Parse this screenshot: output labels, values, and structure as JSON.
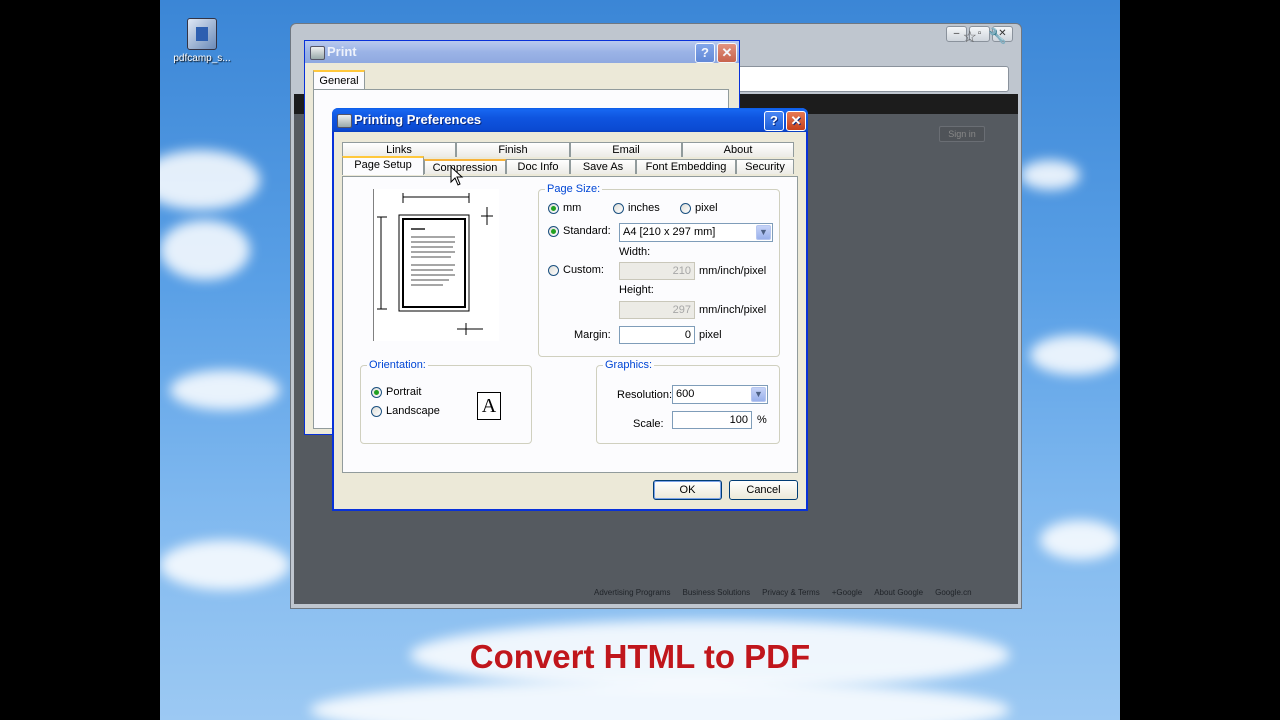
{
  "desktop": {
    "icon_label": "pdfcamp_s..."
  },
  "browser": {
    "controls": {
      "minimize": "–",
      "restore": "▫",
      "close": "✕"
    },
    "sign_in": "Sign in",
    "footer_links": [
      "Advertising Programs",
      "Business Solutions",
      "Privacy & Terms",
      "+Google",
      "About Google",
      "Google.cn"
    ]
  },
  "print_dialog": {
    "title": "Print",
    "tab": "General",
    "help": "?",
    "close": "✕"
  },
  "prefs": {
    "title": "Printing Preferences",
    "help": "?",
    "close": "✕",
    "tabs_row1": [
      "Links",
      "Finish",
      "Email",
      "About"
    ],
    "tabs_row2": [
      "Page Setup",
      "Compression",
      "Doc Info",
      "Save As",
      "Font Embedding",
      "Security"
    ],
    "selected_tab": "Page Setup",
    "page_size": {
      "label": "Page Size:",
      "units": [
        "mm",
        "inches",
        "pixel"
      ],
      "selected_unit": "mm",
      "standard_label": "Standard:",
      "standard_value": "A4 [210 x 297 mm]",
      "custom_label": "Custom:",
      "width_label": "Width:",
      "width_value": "210",
      "height_label": "Height:",
      "height_value": "297",
      "unit_suffix": "mm/inch/pixel",
      "margin_label": "Margin:",
      "margin_value": "0",
      "margin_unit": "pixel"
    },
    "orientation": {
      "label": "Orientation:",
      "options": [
        "Portrait",
        "Landscape"
      ],
      "selected": "Portrait",
      "glyph": "A"
    },
    "graphics": {
      "label": "Graphics:",
      "resolution_label": "Resolution:",
      "resolution_value": "600",
      "scale_label": "Scale:",
      "scale_value": "100",
      "scale_unit": "%"
    },
    "ok": "OK",
    "cancel": "Cancel"
  },
  "caption": "Convert HTML to PDF"
}
